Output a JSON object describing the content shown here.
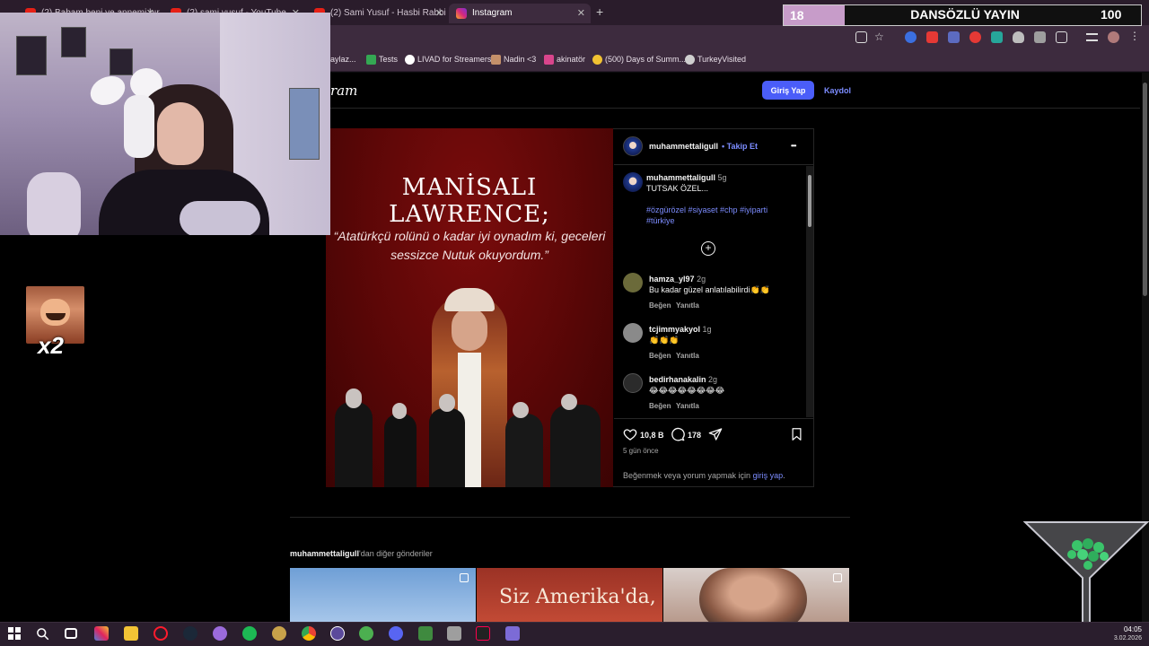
{
  "browser": {
    "tabs": [
      {
        "title": "(2) Babam beni ve annemi bıra...",
        "color": "#e62117",
        "active": false
      },
      {
        "title": "(2) sami yusuf - YouTube",
        "color": "#e62117",
        "active": false
      },
      {
        "title": "(2) Sami Yusuf - Hasbi Rabbi (C...",
        "color": "#e62117",
        "active": false
      },
      {
        "title": "Instagram",
        "color": "#d6297b",
        "active": true
      }
    ],
    "new_tab": "+",
    "bookmarks": [
      {
        "label": "Tests",
        "color": "#34a853"
      },
      {
        "label": "LIVAD for Streamers",
        "color": "#ffffff"
      },
      {
        "label": "Nadin <3",
        "color": "#c4906a"
      },
      {
        "label": "akinatör",
        "color": "#d9458c"
      },
      {
        "label": "(500) Days of Summ...",
        "color": "#f1c232"
      },
      {
        "label": "TurkeyVisited",
        "color": "#cfcfcf"
      }
    ],
    "bookmark_partial": "aylaz..."
  },
  "overlay": {
    "counter_left": "18",
    "counter_title": "DANSÖZLÜ YAYIN",
    "counter_right": "100",
    "emote_multiplier": "x2"
  },
  "instagram": {
    "logo": "ram",
    "login_button": "Giriş Yap",
    "signup_link": "Kaydol",
    "post": {
      "image_title": "MANİSALI LAWRENCE;",
      "image_quote": "“Atatürkçü rolünü o kadar iyi oynadım ki, geceleri sessizce Nutuk okuyordum.”",
      "username": "muhammettaligull",
      "follow": "• Takip Et",
      "more": "•••",
      "caption": {
        "username": "muhammettaligull",
        "time": "5g",
        "text": "TUTSAK ÖZEL...",
        "hashtags": "#özgürözel #siyaset #chp #iyiparti #türkiye"
      },
      "load_more": "+",
      "comments": [
        {
          "username": "hamza_yl97",
          "time": "2g",
          "text": "Bu kadar güzel anlatılabilirdi👏👏",
          "like": "Beğen",
          "reply": "Yanıtla",
          "avatar_color": "#6b6a3a"
        },
        {
          "username": "tcjimmyakyol",
          "time": "1g",
          "text": "👏👏👏",
          "like": "Beğen",
          "reply": "Yanıtla",
          "avatar_color": "#8a8a8a"
        },
        {
          "username": "bedirhanakalin",
          "time": "2g",
          "text": "😂😂😂😂😂😂😂😂",
          "like": "Beğen",
          "reply": "Yanıtla",
          "avatar_color": "#2b2b2b"
        }
      ],
      "likes": "10,8 B",
      "comment_count": "178",
      "age": "5 gün önce",
      "login_hint_prefix": "Beğenmek veya yorum yapmak için ",
      "login_hint_link": "giriş yap",
      "login_hint_suffix": "."
    },
    "more_posts": {
      "username": "muhammettaligull",
      "suffix": "'dan diğer gönderiler",
      "thumb2_text": "Siz Amerika'da,"
    }
  },
  "taskbar": {
    "time": "04:05",
    "date": "3.02.2026",
    "app_colors": [
      "#ffffff",
      "#ffffff",
      "#ffffff",
      "#8ab4f8",
      "#f2c335",
      "#e0245e",
      "#4f7ed8",
      "#9b6bdb",
      "#1db954",
      "#c8a24a",
      "#34a853",
      "#5b4a9b",
      "#4caf50",
      "#9575cd",
      "#3f8a3f",
      "#9e9e9e",
      "#222222",
      "#7c6bd6"
    ]
  }
}
